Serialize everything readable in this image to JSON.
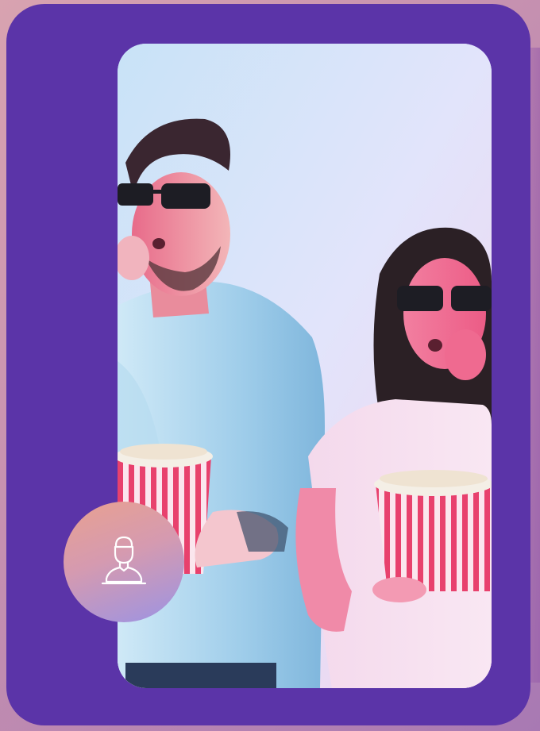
{
  "badge": {
    "icon": "user-icon"
  },
  "colors": {
    "card_background": "#5b34a8",
    "page_background": "#c48fb0",
    "badge_gradient_start": "#e9a190",
    "badge_gradient_end": "#9b93e4"
  },
  "photo": {
    "subject": "two-people-eating-popcorn-in-3d-glasses"
  }
}
